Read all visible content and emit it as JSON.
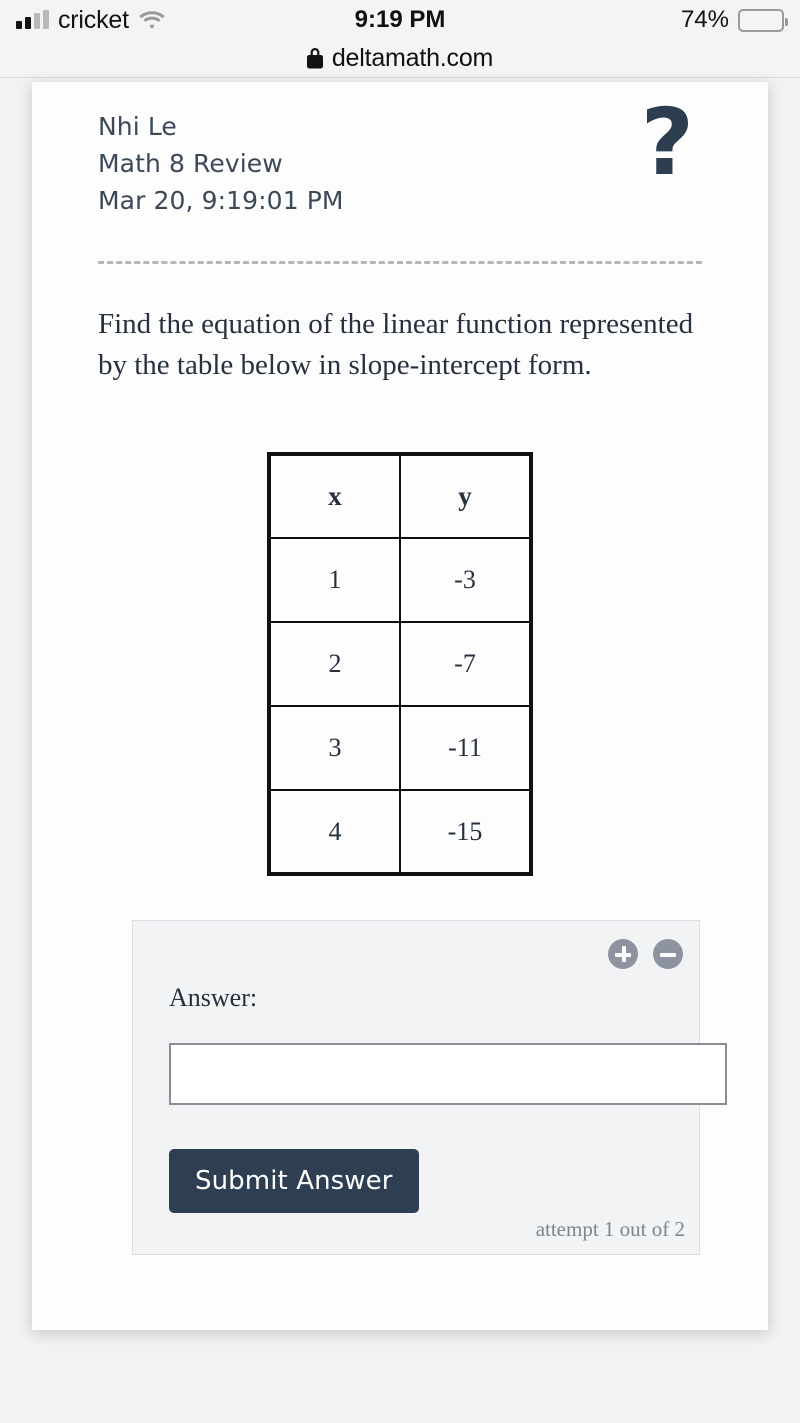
{
  "status_bar": {
    "carrier": "cricket",
    "signal_icon": "signal-bars-icon",
    "wifi_icon": "wifi-icon",
    "time": "9:19 PM",
    "battery_percent": "74%",
    "battery_level": 74,
    "battery_icon": "battery-icon"
  },
  "browser": {
    "lock_icon": "lock-icon",
    "url": "deltamath.com"
  },
  "assignment": {
    "student_name": "Nhi Le",
    "assignment_title": "Math 8 Review",
    "timestamp": "Mar 20, 9:19:01 PM",
    "help_icon": "question-mark-icon"
  },
  "problem": {
    "prompt": "Find the equation of the linear function represented by the table below in slope-intercept form."
  },
  "table_data": {
    "type": "table",
    "columns": [
      "x",
      "y"
    ],
    "rows": [
      [
        "1",
        "-3"
      ],
      [
        "2",
        "-7"
      ],
      [
        "3",
        "-11"
      ],
      [
        "4",
        "-15"
      ]
    ]
  },
  "answer_panel": {
    "zoom_in_icon": "plus-circle-icon",
    "zoom_out_icon": "minus-circle-icon",
    "answer_label": "Answer:",
    "answer_value": "",
    "answer_placeholder": "",
    "submit_label": "Submit Answer",
    "attempt_text": "attempt 1 out of 2"
  },
  "colors": {
    "brand_navy": "#2e3f54",
    "panel_bg": "#f1f3f5",
    "page_bg": "#f2f2f2",
    "control_gray": "#8d949f"
  }
}
